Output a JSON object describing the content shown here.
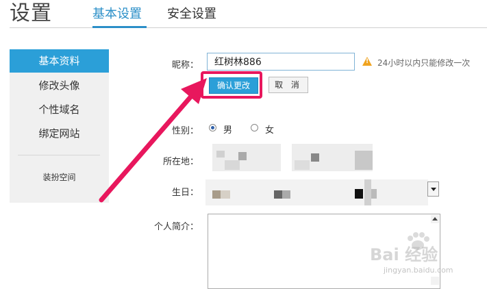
{
  "header": {
    "title": "设置",
    "tabs": [
      {
        "label": "基本设置",
        "active": true
      },
      {
        "label": "安全设置",
        "active": false
      }
    ]
  },
  "sidebar": {
    "items": [
      {
        "label": "基本资料",
        "active": true
      },
      {
        "label": "修改头像",
        "active": false
      },
      {
        "label": "个性域名",
        "active": false
      },
      {
        "label": "绑定网站",
        "active": false
      }
    ],
    "extra": "装扮空间"
  },
  "form": {
    "nickname_label": "昵称：",
    "nickname_value": "红树林886",
    "nickname_notice": "24小时以内只能修改一次",
    "confirm_label": "确认更改",
    "cancel_label": "取 消",
    "gender_label": "性别：",
    "gender_options": [
      "男",
      "女"
    ],
    "gender_selected": "男",
    "location_label": "所在地：",
    "birthday_label": "生日：",
    "bio_label": "个人简介："
  },
  "watermark": {
    "text": "Bai 经验",
    "sub": "jingyan.baidu.com"
  },
  "colors": {
    "accent": "#2b9fd8",
    "highlight": "#e8175d",
    "warning": "#f0a31f"
  },
  "icons": {
    "warning": "warning-triangle-icon",
    "arrow": "pink-arrow-annotation"
  }
}
